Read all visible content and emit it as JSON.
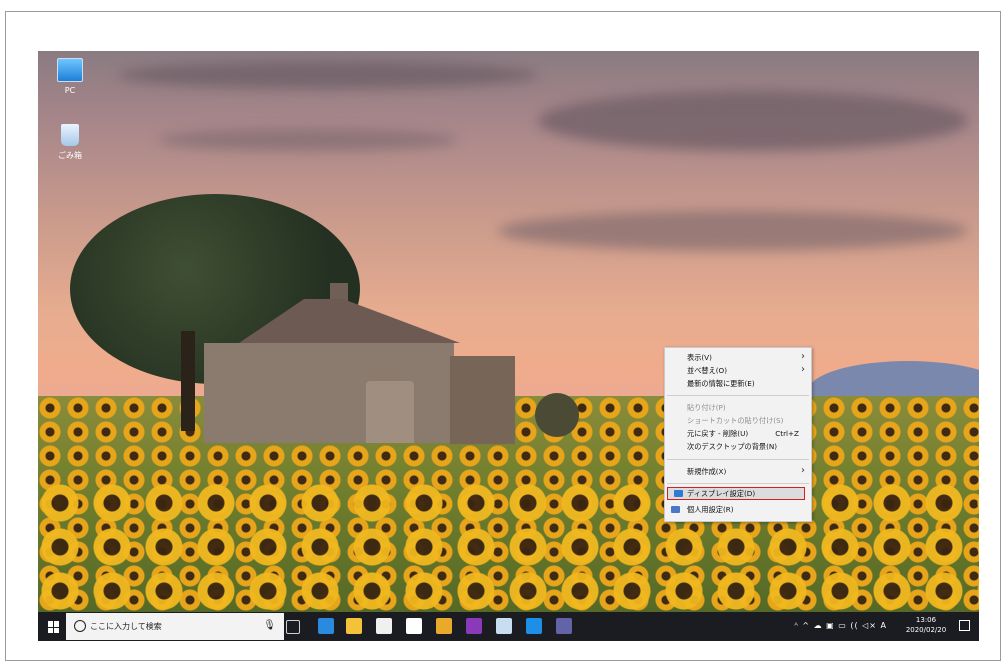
{
  "desktop": {
    "icons": [
      {
        "label": "PC",
        "icon": "pc-icon"
      },
      {
        "label": "ごみ箱",
        "icon": "recycle-bin-icon"
      }
    ]
  },
  "context_menu": {
    "items": [
      {
        "label": "表示(V)",
        "submenu": true,
        "disabled": false
      },
      {
        "label": "並べ替え(O)",
        "submenu": true,
        "disabled": false
      },
      {
        "label": "最新の情報に更新(E)",
        "submenu": false,
        "disabled": false
      },
      {
        "label": "貼り付け(P)",
        "submenu": false,
        "disabled": true
      },
      {
        "label": "ショートカットの貼り付け(S)",
        "submenu": false,
        "disabled": true
      },
      {
        "label": "元に戻す - 削除(U)",
        "shortcut": "Ctrl+Z",
        "submenu": false,
        "disabled": false
      },
      {
        "label": "次のデスクトップの背景(N)",
        "submenu": false,
        "disabled": false
      },
      {
        "label": "新規作成(X)",
        "submenu": true,
        "disabled": false
      },
      {
        "label": "ディスプレイ設定(D)",
        "submenu": false,
        "highlighted": true
      },
      {
        "label": "個人用設定(R)",
        "submenu": false
      }
    ],
    "submenu_arrow": "›"
  },
  "taskbar": {
    "search_placeholder": "ここに入力して検索",
    "mic_icon": "🎙",
    "apps": [
      {
        "icon": "task-view-icon",
        "color": "#d0d0d0"
      },
      {
        "icon": "edge-icon",
        "color": "#2a8ae0"
      },
      {
        "icon": "file-explorer-icon",
        "color": "#f3c13a"
      },
      {
        "icon": "store-icon",
        "color": "#f0f0f0"
      },
      {
        "icon": "mail-icon",
        "color": "#ffffff"
      },
      {
        "icon": "chrome-icon",
        "color": "#e9a92b"
      },
      {
        "icon": "onenote-icon",
        "color": "#8a3ab9"
      },
      {
        "icon": "snipping-icon",
        "color": "#c9ddf0"
      },
      {
        "icon": "remote-icon",
        "color": "#1e8fe6"
      },
      {
        "icon": "teams-icon",
        "color": "#6264a7"
      }
    ],
    "tray_text": "ᴬ  ^  ☁  ▣  ▭  ((  ◁×  A",
    "time": "13:06",
    "date": "2020/02/20"
  }
}
